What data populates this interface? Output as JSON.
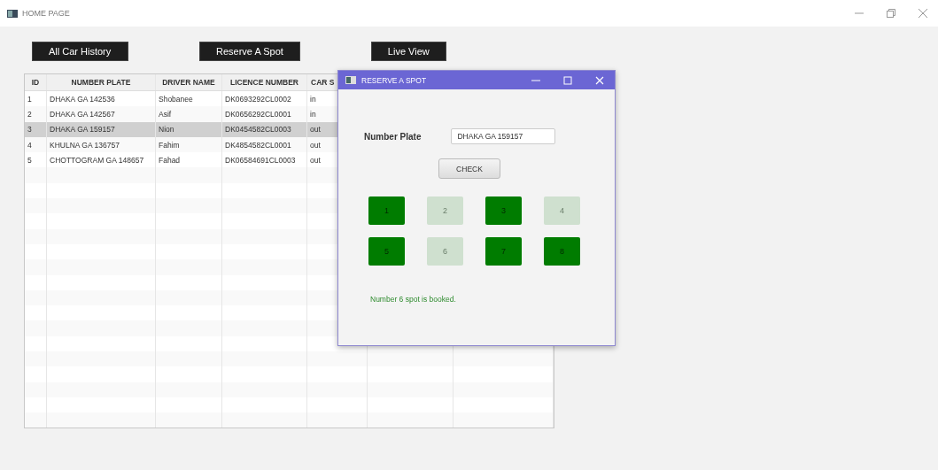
{
  "window": {
    "title": "HOME PAGE"
  },
  "buttons": [
    "All Car History",
    "Reserve A Spot",
    "Live View"
  ],
  "table": {
    "columns": [
      "ID",
      "NUMBER PLATE",
      "DRIVER NAME",
      "LICENCE NUMBER",
      "CAR S"
    ],
    "rows": [
      {
        "cells": [
          "1",
          "DHAKA GA 142536",
          "Shobanee",
          "DK0693292CL0002",
          "in"
        ],
        "selected": false
      },
      {
        "cells": [
          "2",
          "DHAKA GA 142567",
          "Asif",
          "DK0656292CL0001",
          "in"
        ],
        "selected": false
      },
      {
        "cells": [
          "3",
          "DHAKA GA 159157",
          "Nion",
          "DK0454582CL0003",
          "out"
        ],
        "selected": true
      },
      {
        "cells": [
          "4",
          "KHULNA GA 136757",
          "Fahim",
          "DK4854582CL0001",
          "out"
        ],
        "selected": false
      },
      {
        "cells": [
          "5",
          "CHOTTOGRAM GA 148657",
          "Fahad",
          "DK06584691CL0003",
          "out"
        ],
        "selected": false
      }
    ]
  },
  "dialog": {
    "title": "RESERVE A SPOT",
    "field_label": "Number Plate",
    "field_value": "DHAKA GA 159157",
    "check_button": "CHECK",
    "spots": [
      {
        "label": "1",
        "disabled": false
      },
      {
        "label": "2",
        "disabled": true
      },
      {
        "label": "3",
        "disabled": false
      },
      {
        "label": "4",
        "disabled": true
      },
      {
        "label": "5",
        "disabled": false
      },
      {
        "label": "6",
        "disabled": true
      },
      {
        "label": "7",
        "disabled": false
      },
      {
        "label": "8",
        "disabled": false
      }
    ],
    "message": "Number 6 spot is booked."
  }
}
